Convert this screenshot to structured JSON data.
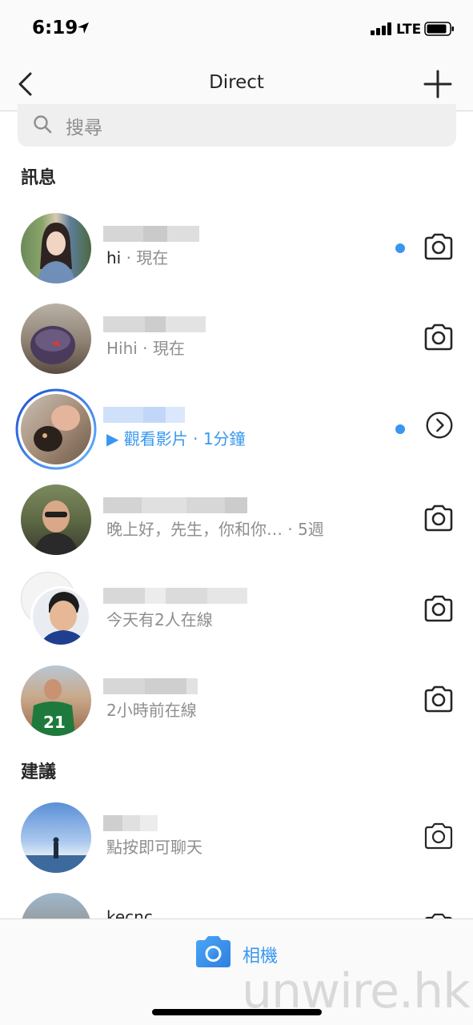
{
  "status_bar": {
    "time": "6:19",
    "network": "LTE"
  },
  "nav": {
    "title": "Direct"
  },
  "search": {
    "placeholder": "搜尋"
  },
  "sections": {
    "messages_title": "訊息",
    "suggestions_title": "建議"
  },
  "conversations": [
    {
      "preview_main": "hi",
      "preview_rest": " · 現在",
      "unread": true,
      "action_icon": "camera-icon"
    },
    {
      "preview_main": "Hihi",
      "preview_rest": " · 現在",
      "unread": false,
      "action_icon": "camera-icon"
    },
    {
      "preview_main": "▶ 觀看影片",
      "preview_rest": " · 1分鐘",
      "unread": true,
      "action_icon": "chevron-right-icon"
    },
    {
      "preview_main": "晚上好，先生，你和你…",
      "preview_rest": "   · 5週",
      "unread": false,
      "action_icon": "camera-icon"
    },
    {
      "preview_main": "今天有2人在線",
      "preview_rest": "",
      "unread": false,
      "action_icon": "camera-icon"
    },
    {
      "preview_main": "2小時前在線",
      "preview_rest": "",
      "unread": false,
      "action_icon": "camera-icon"
    }
  ],
  "suggestions": [
    {
      "preview_main": "點按即可聊天",
      "action_icon": "camera-icon"
    },
    {
      "username": "kecnc",
      "action_icon": "camera-icon"
    }
  ],
  "bottom_bar": {
    "camera_label": "相機"
  },
  "watermark": "unwire.hk",
  "colors": {
    "accent": "#3897f0",
    "text": "#262626",
    "secondary": "#8e8e8e"
  }
}
